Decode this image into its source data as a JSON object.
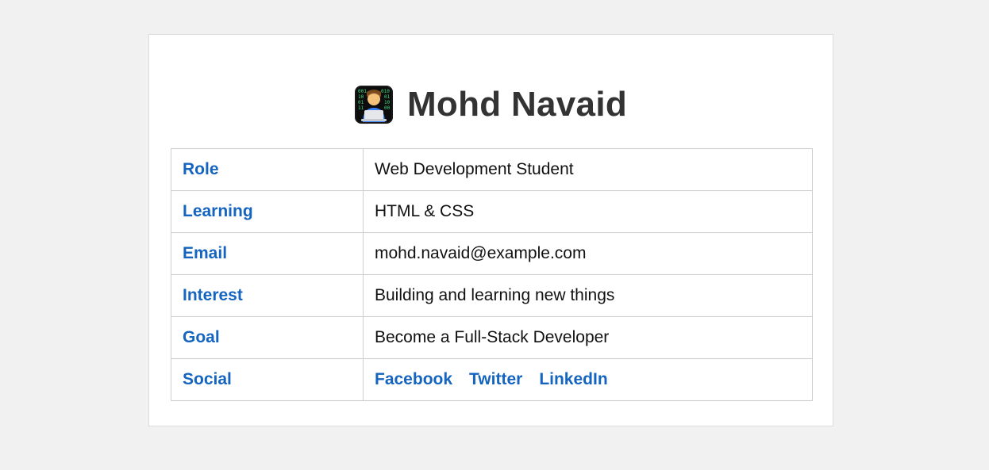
{
  "header": {
    "name": "Mohd Navaid",
    "avatar_icon": "technologist-emoji-icon"
  },
  "colors": {
    "page_background": "#f1f1f1",
    "card_background": "#ffffff",
    "key_text": "#1565c0",
    "title_text": "#333333",
    "link": "#1565c0"
  },
  "rows": [
    {
      "key": "Role",
      "value": "Web Development Student"
    },
    {
      "key": "Learning",
      "value": "HTML & CSS"
    },
    {
      "key": "Email",
      "value": "mohd.navaid@example.com"
    },
    {
      "key": "Interest",
      "value": "Building and learning new things"
    },
    {
      "key": "Goal",
      "value": "Become a Full-Stack Developer"
    },
    {
      "key": "Social",
      "links": [
        "Facebook",
        "Twitter",
        "LinkedIn"
      ]
    }
  ]
}
